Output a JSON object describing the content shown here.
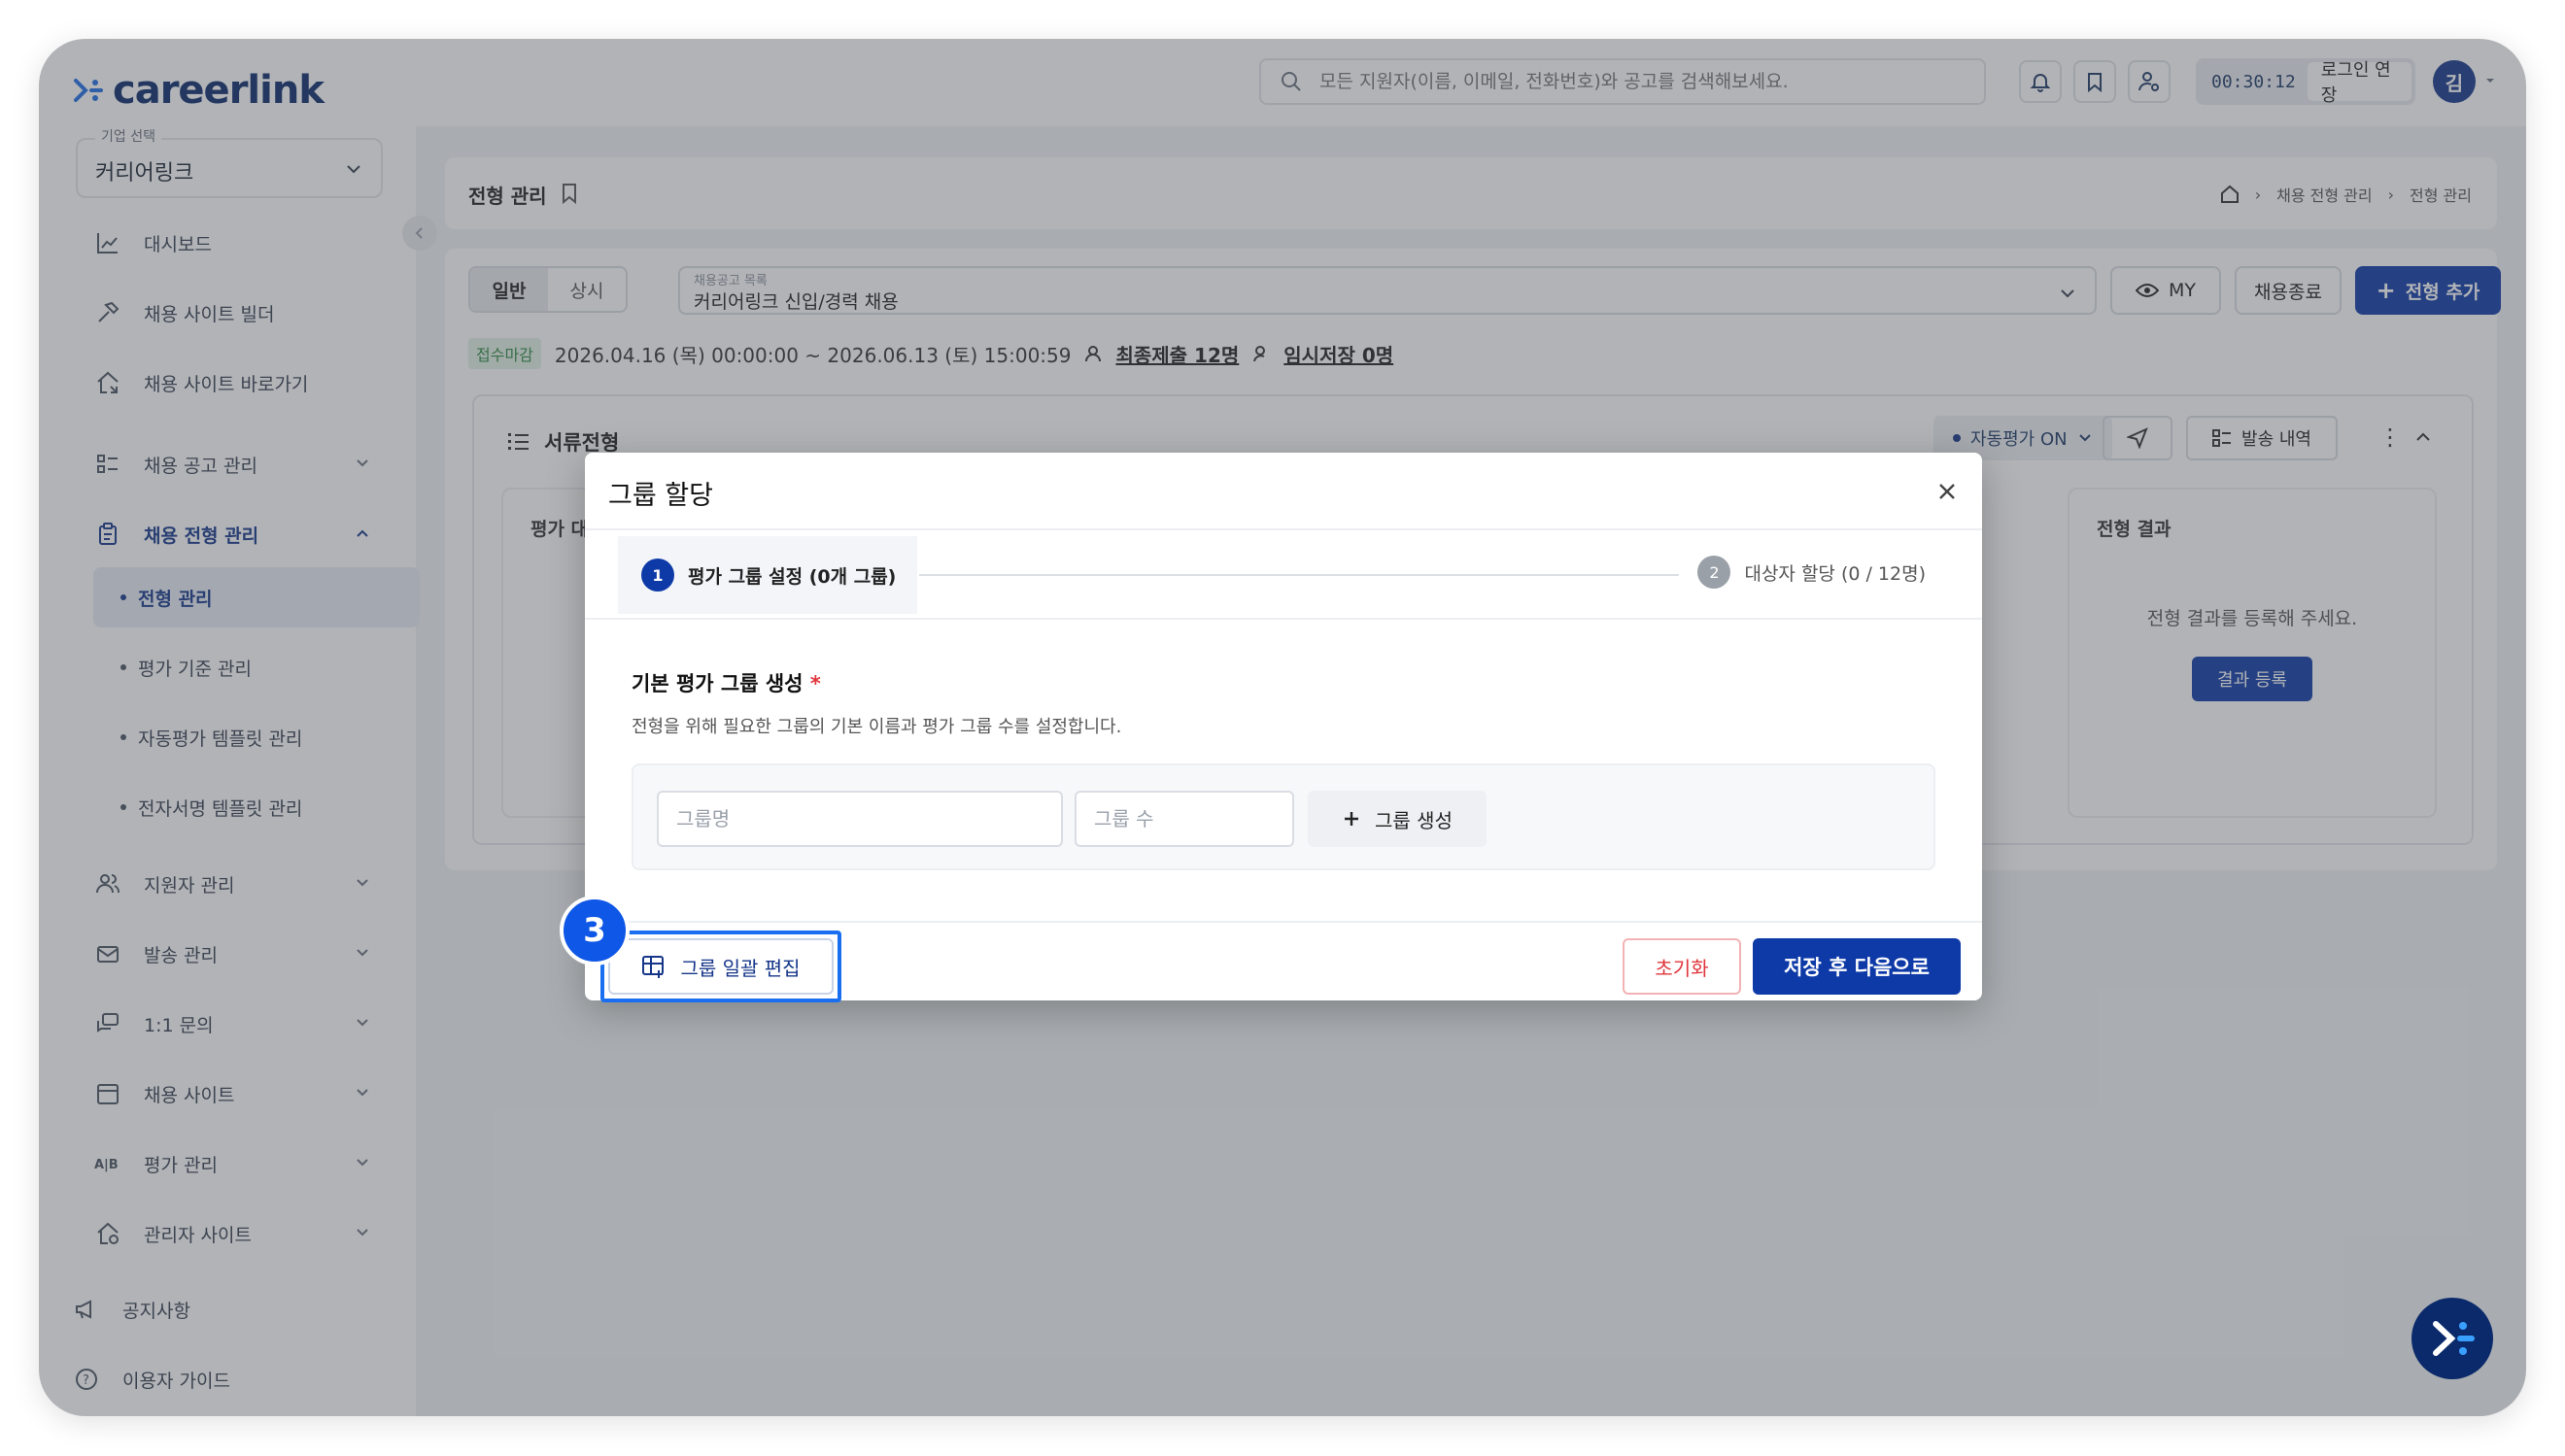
{
  "brand": {
    "name": "careerlink",
    "accent": "#0e3aa8",
    "logo_color": "#0b2a6b"
  },
  "header": {
    "search_placeholder": "모든 지원자(이름, 이메일, 전화번호)와 공고를 검색해보세요.",
    "timer": "00:30:12",
    "extend_label": "로그인 연장",
    "avatar_initial": "김",
    "icons": [
      "bell-icon",
      "bookmark-icon",
      "user-settings-icon"
    ]
  },
  "sidebar": {
    "company_label": "기업 선택",
    "company_value": "커리어링크",
    "items": [
      {
        "label": "대시보드",
        "icon": "chart-icon"
      },
      {
        "label": "채용 사이트 빌더",
        "icon": "hammer-icon"
      },
      {
        "label": "채용 사이트 바로가기",
        "icon": "home-link-icon"
      },
      {
        "label": "채용 공고 관리",
        "icon": "list-icon"
      },
      {
        "label": "채용 전형 관리",
        "icon": "clipboard-icon"
      },
      {
        "label": "지원자 관리",
        "icon": "people-icon"
      },
      {
        "label": "발송 관리",
        "icon": "mail-icon"
      },
      {
        "label": "1:1 문의",
        "icon": "chat-icon"
      },
      {
        "label": "채용 사이트",
        "icon": "calendar-icon"
      },
      {
        "label": "평가 관리",
        "icon": "ab-icon"
      },
      {
        "label": "관리자 사이트",
        "icon": "house-gear-icon"
      }
    ],
    "subitems": [
      {
        "label": "전형 관리"
      },
      {
        "label": "평가 기준 관리"
      },
      {
        "label": "자동평가 템플릿 관리"
      },
      {
        "label": "전자서명 템플릿 관리"
      }
    ],
    "footer": [
      {
        "label": "공지사항",
        "icon": "megaphone-icon"
      },
      {
        "label": "이용자 가이드",
        "icon": "help-icon"
      }
    ]
  },
  "page": {
    "title": "전형 관리",
    "breadcrumb": [
      "채용 전형 관리",
      "전형 관리"
    ],
    "tabs": [
      "일반",
      "상시"
    ],
    "posting_label": "채용공고 목록",
    "posting_value": "커리어링크 신입/경력 채용",
    "my_label": "MY",
    "close_label": "채용종료",
    "add_label": "전형 추가",
    "status": "접수마감",
    "period": "2026.04.16 (목) 00:00:00 ~ 2026.06.13 (토) 15:00:59",
    "final_submit": "최종제출 12명",
    "temp_save": "임시저장 0명",
    "stage_title": "서류전형",
    "auto_eval": "자동평가 ON",
    "send_history": "발송 내역",
    "eval_col_head": "평가 대",
    "result_head": "전형 결과",
    "result_text": "전형 결과를 등록해 주세요.",
    "result_btn": "결과 등록"
  },
  "modal": {
    "title": "그룹 할당",
    "step1": "평가 그룹 설정 (0개 그룹)",
    "step2": "대상자 할당 (0 / 12명)",
    "step1_num": "1",
    "step2_num": "2",
    "section_title": "기본 평가 그룹 생성",
    "required_mark": "*",
    "description": "전형을 위해 필요한 그룹의 기본 이름과 평가 그룹 수를 설정합니다.",
    "group_name_placeholder": "그룹명",
    "group_count_placeholder": "그룹 수",
    "create_label": "그룹 생성",
    "bulk_edit_label": "그룹 일괄 편집",
    "reset_label": "초기화",
    "save_next_label": "저장 후 다음으로",
    "callout_number": "3"
  }
}
